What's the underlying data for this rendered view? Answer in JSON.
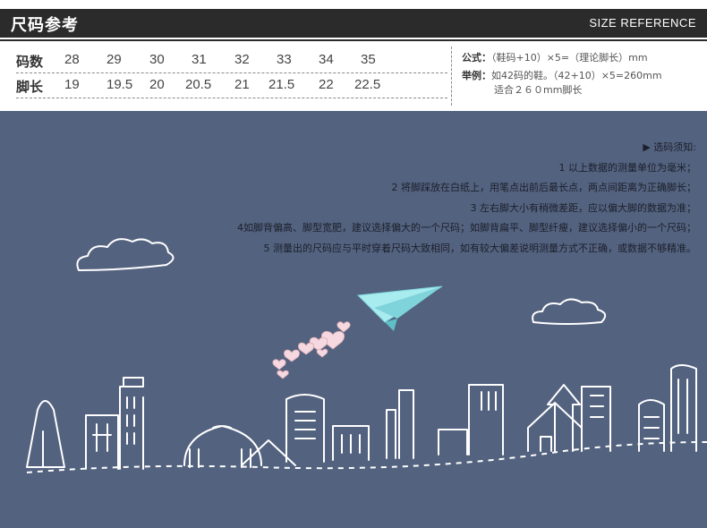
{
  "header": {
    "title": "尺码参考",
    "subtitle": "SIZE REFERENCE"
  },
  "size_table": {
    "size_label": "码数",
    "length_label": "脚长",
    "sizes": [
      "28",
      "29",
      "30",
      "31",
      "32",
      "33",
      "34",
      "35"
    ],
    "lengths": [
      "19",
      "19.5",
      "20",
      "20.5",
      "21",
      "21.5",
      "22",
      "22.5"
    ]
  },
  "formula": {
    "formula_label": "公式：",
    "formula_text": "（鞋码+10）×5=（理论脚长）mm",
    "example_label": "举例：",
    "example_text": "如42码的鞋。（42+10）×5=260mm",
    "example_result": "适合２６０mm脚长"
  },
  "notes": {
    "heading": "▶ 选码须知:",
    "items": [
      "1  以上数据的测量单位为毫米；",
      "2  将脚踩放在白纸上，用笔点出前后最长点，两点间距离为正确脚长；",
      "3  左右脚大小有稍微差距，应以偏大脚的数据为准；",
      "4如脚背偏高、脚型宽肥，建议选择偏大的一个尺码；如脚背扁平、脚型纤瘦，建议选择偏小的一个尺码；",
      "5  测量出的尺码应与平时穿着尺码大致相同，如有较大偏差说明测量方式不正确，或数据不够精准。"
    ]
  },
  "colors": {
    "panel": "#53627f",
    "header": "#2b2b2b",
    "plane": "#a8ecf0",
    "hearts": "#f6d9e0"
  }
}
